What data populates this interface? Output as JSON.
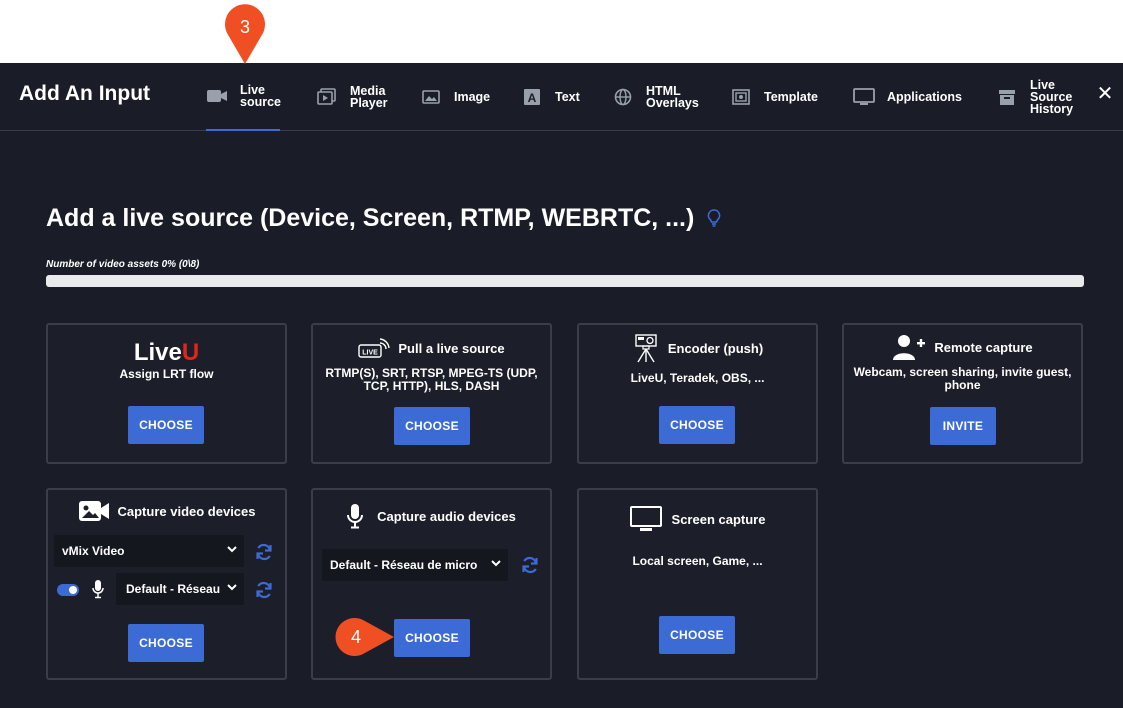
{
  "dialog": {
    "title": "Add An Input",
    "close_glyph": "✕"
  },
  "tabs": [
    {
      "l1": "Live",
      "l2": "source",
      "icon": "camera-icon"
    },
    {
      "l1": "Media",
      "l2": "Player",
      "icon": "media-player-icon"
    },
    {
      "l1": "Image",
      "l2": "",
      "icon": "image-icon"
    },
    {
      "l1": "Text",
      "l2": "",
      "icon": "text-icon"
    },
    {
      "l1": "HTML",
      "l2": "Overlays",
      "icon": "globe-icon"
    },
    {
      "l1": "Template",
      "l2": "",
      "icon": "template-icon"
    },
    {
      "l1": "Applications",
      "l2": "",
      "icon": "monitor-icon"
    },
    {
      "l1": "Live",
      "l2": "Source",
      "l3": "History",
      "icon": "archive-icon"
    }
  ],
  "main": {
    "heading": "Add a live source (Device, Screen, RTMP, WEBRTC, ...)",
    "assets_label": "Number of video assets 0% (0\\8)",
    "assets_progress_percent": 0
  },
  "cards": {
    "liveu": {
      "logo_text_a": "Live",
      "logo_text_b": "U",
      "subtitle": "Assign LRT flow",
      "button": "CHOOSE"
    },
    "pull": {
      "title": "Pull a live source",
      "subtitle": "RTMP(S), SRT, RTSP, MPEG-TS (UDP, TCP, HTTP), HLS, DASH",
      "button": "CHOOSE",
      "icon_text": "LIVE"
    },
    "encoder": {
      "title": "Encoder (push)",
      "subtitle": "LiveU, Teradek, OBS, ...",
      "button": "CHOOSE"
    },
    "remote": {
      "title": "Remote capture",
      "subtitle": "Webcam, screen sharing, invite guest, phone",
      "button": "INVITE"
    },
    "video": {
      "title": "Capture video devices",
      "video_select": "vMix Video",
      "audio_select": "Default - Réseau de micro",
      "button": "CHOOSE",
      "toggle_on": true
    },
    "audio": {
      "title": "Capture audio devices",
      "audio_select": "Default - Réseau de micro",
      "button": "CHOOSE"
    },
    "screen": {
      "title": "Screen capture",
      "subtitle": "Local screen, Game, ...",
      "button": "CHOOSE"
    }
  },
  "callouts": {
    "step3": "3",
    "step4": "4"
  },
  "colors": {
    "accent": "#3d6bd6",
    "callout": "#f04e23",
    "background": "#1a1d27",
    "liveu_red": "#e0261b"
  }
}
